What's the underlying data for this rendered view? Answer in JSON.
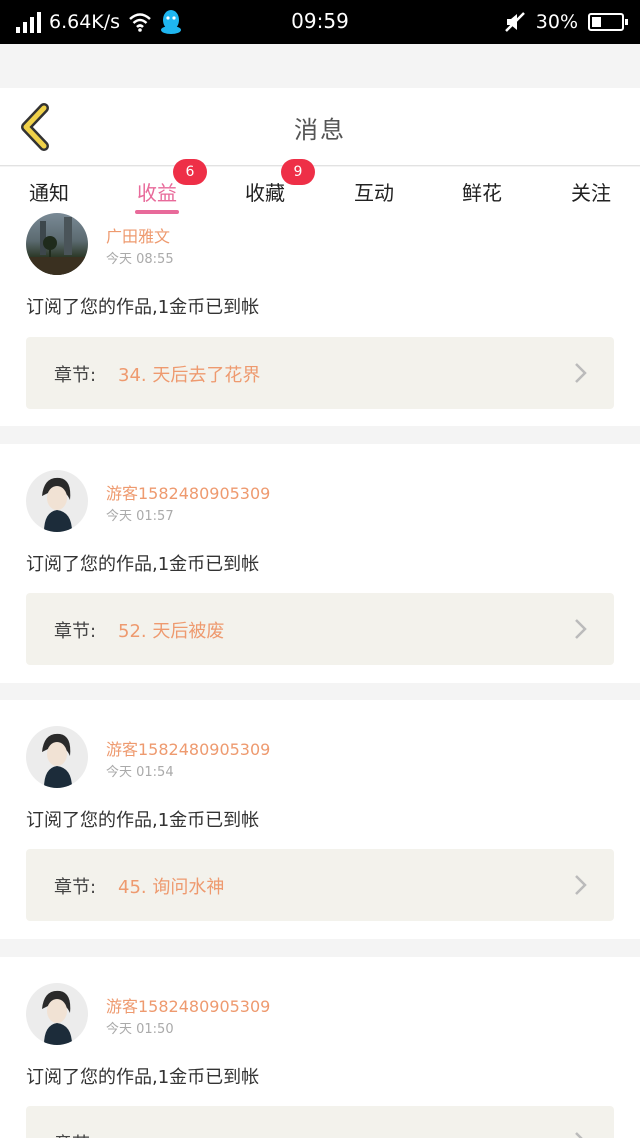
{
  "statusbar": {
    "speed": "6.64K/s",
    "time": "09:59",
    "battery": "30%",
    "battery_level": 0.3
  },
  "header": {
    "title": "消息"
  },
  "tabs": [
    {
      "label": "通知"
    },
    {
      "label": "收益",
      "badge": "6",
      "active": true
    },
    {
      "label": "收藏",
      "badge": "9"
    },
    {
      "label": "互动"
    },
    {
      "label": "鲜花"
    },
    {
      "label": "关注"
    }
  ],
  "messages": [
    {
      "user": "广田雅文",
      "time": "今天 08:55",
      "text": "订阅了您的作品,1金币已到帐",
      "chapter_label": "章节:",
      "chapter": "34. 天后去了花界"
    },
    {
      "user": "游客1582480905309",
      "time": "今天 01:57",
      "text": "订阅了您的作品,1金币已到帐",
      "chapter_label": "章节:",
      "chapter": "52. 天后被废"
    },
    {
      "user": "游客1582480905309",
      "time": "今天 01:54",
      "text": "订阅了您的作品,1金币已到帐",
      "chapter_label": "章节:",
      "chapter": "45. 询问水神"
    },
    {
      "user": "游客1582480905309",
      "time": "今天 01:50",
      "text": "订阅了您的作品,1金币已到帐",
      "chapter_label": "章节:",
      "chapter": ""
    }
  ],
  "colors": {
    "accent": "#e86a9a",
    "badge": "#ee2f47",
    "username": "#ee9a6f",
    "chapter_bg": "#f3f2ec",
    "back_arrow": "#f0d24a"
  }
}
